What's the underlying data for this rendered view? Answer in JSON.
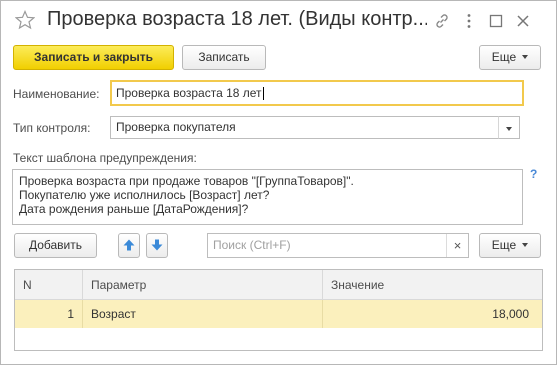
{
  "window": {
    "title": "Проверка возраста 18 лет. (Виды контр..."
  },
  "toolbar": {
    "save_close_label": "Записать и закрыть",
    "save_label": "Записать",
    "more_label": "Еще"
  },
  "form": {
    "name_label": "Наименование:",
    "name_value": "Проверка возраста 18 лет",
    "type_label": "Тип контроля:",
    "type_value": "Проверка покупателя",
    "template_label": "Текст шаблона предупреждения:",
    "template_lines": [
      "Проверка возраста при продаже товаров \"[ГруппаТоваров]\".",
      "Покупателю уже исполнилось [Возраст] лет?",
      "Дата рождения раньше [ДатаРождения]?"
    ],
    "help": "?"
  },
  "table_toolbar": {
    "add_label": "Добавить",
    "search_placeholder": "Поиск (Ctrl+F)",
    "clear": "×",
    "more_label": "Еще"
  },
  "table": {
    "columns": [
      "N",
      "Параметр",
      "Значение"
    ],
    "rows": [
      {
        "n": "1",
        "param": "Возраст",
        "value": "18,000"
      }
    ]
  },
  "colors": {
    "primary_button": "#f5d800",
    "selected_row": "#fbf0bd",
    "focus_border": "#f2c94c",
    "accent_blue": "#4a8ad7"
  }
}
